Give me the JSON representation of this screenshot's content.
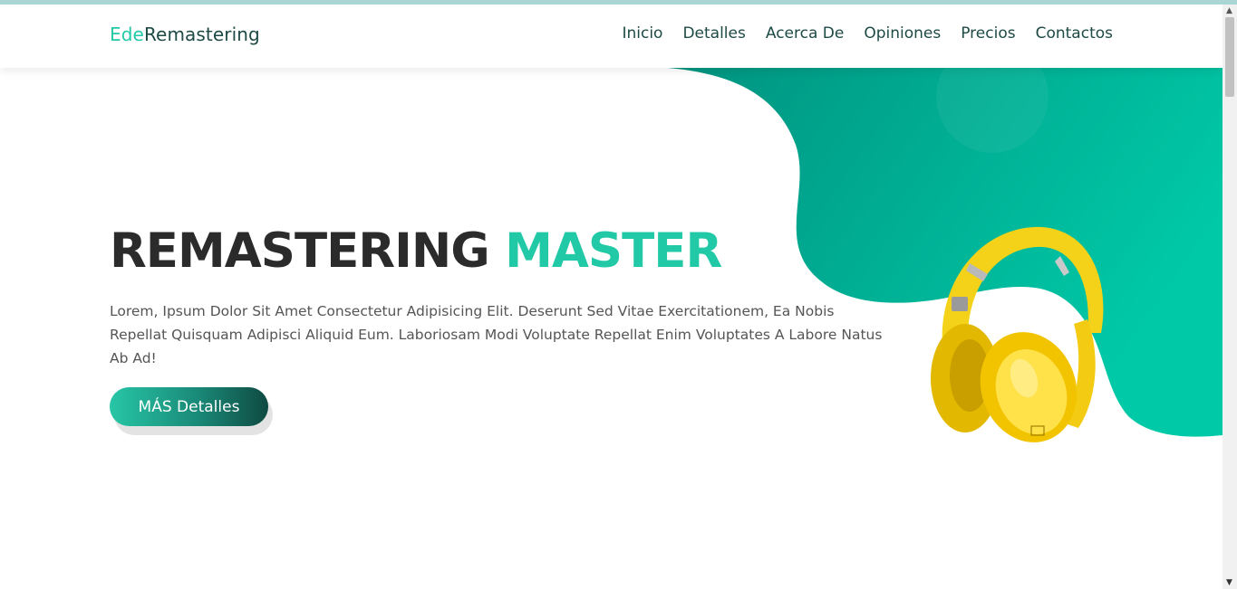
{
  "brand": {
    "accent": "Ede",
    "rest": "Remastering"
  },
  "nav": {
    "items": [
      {
        "label": "Inicio"
      },
      {
        "label": "Detalles"
      },
      {
        "label": "Acerca De"
      },
      {
        "label": "Opiniones"
      },
      {
        "label": "Precios"
      },
      {
        "label": "Contactos"
      }
    ]
  },
  "hero": {
    "title_dark": "REMASTERING",
    "title_accent": "MASTER",
    "text": "Lorem, Ipsum Dolor Sit Amet Consectetur Adipisicing Elit. Deserunt Sed Vitae Exercitationem, Ea Nobis Repellat Quisquam Adipisci Aliquid Eum. Laboriosam Modi Voluptate Repellat Enim Voluptates A Labore Natus Ab Ad!",
    "cta_label": "MÁS Detalles",
    "image_icon": "yellow-headphones"
  },
  "colors": {
    "accent": "#22c9a7",
    "nav_text": "#1d4a45",
    "title_dark": "#2b2b2b",
    "blob_light": "#00c9a7",
    "blob_dark": "#008b7a",
    "headphones": "#f5d21a"
  }
}
